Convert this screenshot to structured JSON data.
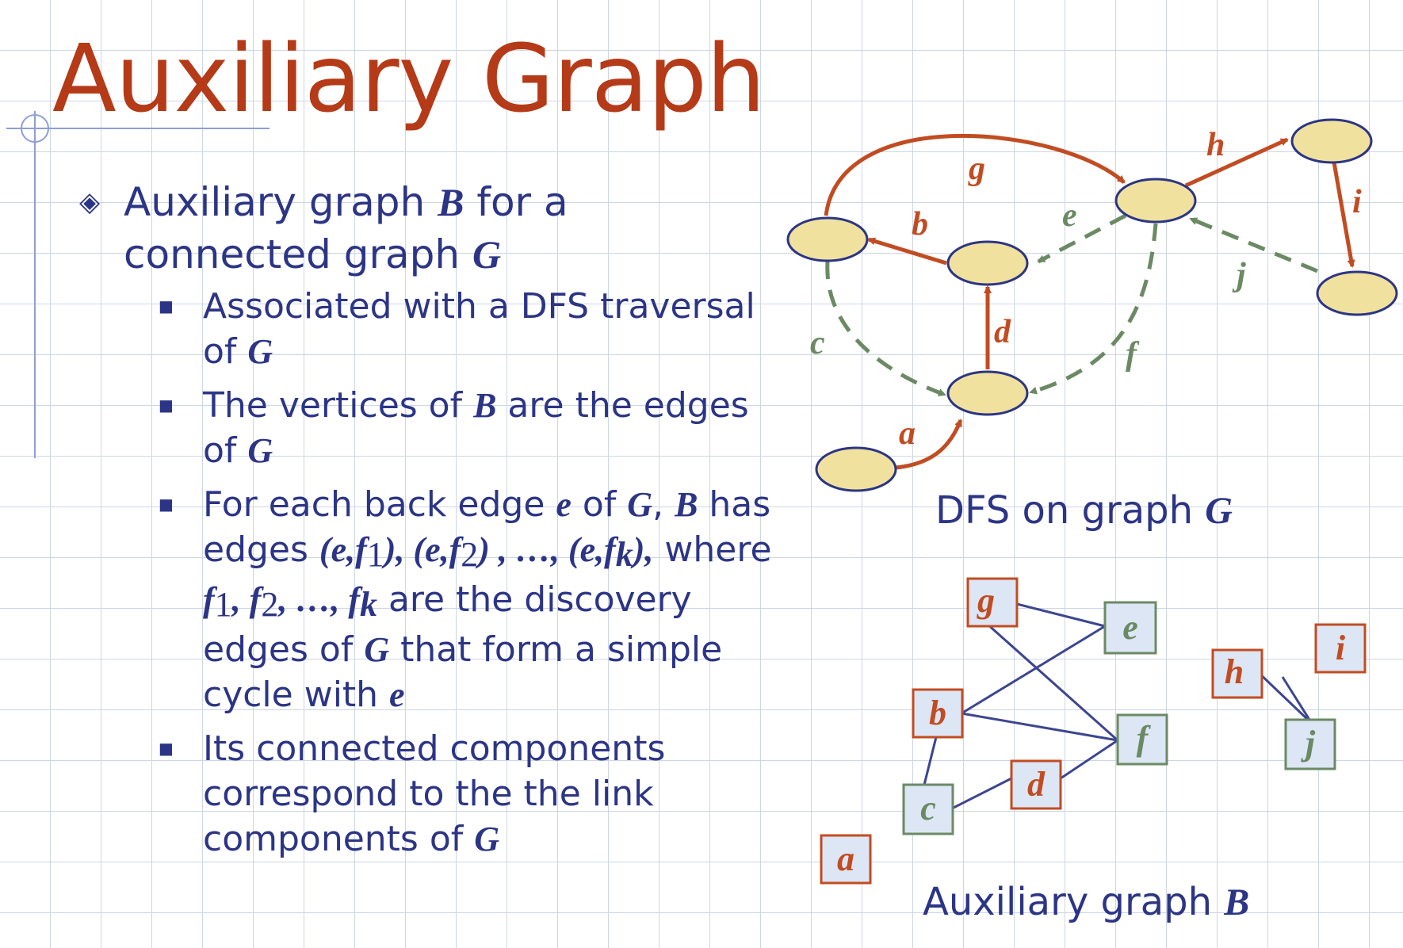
{
  "title": "Auxiliary Graph",
  "bullet": {
    "prefix": "Auxiliary graph ",
    "B": "B",
    "mid": " for a connected graph ",
    "G": "G"
  },
  "subbullets": {
    "s1_a": "Associated with a DFS traversal of ",
    "s1_G": "G",
    "s2_a": "The vertices of ",
    "s2_B": "B",
    "s2_b": " are the edges of ",
    "s2_G": "G",
    "s3_a": "For each back edge ",
    "s3_e": "e",
    "s3_b": " of ",
    "s3_G": "G",
    "s3_c": ", ",
    "s3_B": "B",
    "s3_d": " has edges ",
    "s3_pairs_1": "(e,f",
    "s3_pairs_1s": "1",
    "s3_pairs_2": "), (e,f",
    "s3_pairs_2s": "2",
    "s3_pairs_3": ") , …, (e,f",
    "s3_pairs_3s": "k",
    "s3_pairs_4": "),",
    "s3_where": " where ",
    "s3_f1": "f",
    "s3_f1s": "1",
    "s3_f2": ", f",
    "s3_f2s": "2",
    "s3_fk": ", …, f",
    "s3_fks": "k",
    "s3_e2": " are the discovery edges of ",
    "s3_G2": "G",
    "s3_e3": " that form a simple cycle with ",
    "s3_e4": "e",
    "s4_a": "Its connected components correspond to the  the link components of ",
    "s4_G": "G"
  },
  "captions": {
    "dfs_prefix": "DFS on graph ",
    "dfs_G": "G",
    "aux_prefix": "Auxiliary graph ",
    "aux_B": "B"
  },
  "dfs_edge_labels": {
    "a": "a",
    "b": "b",
    "c": "c",
    "d": "d",
    "e": "e",
    "f": "f",
    "g": "g",
    "h": "h",
    "i": "i",
    "j": "j"
  },
  "aux_nodes": {
    "a": "a",
    "b": "b",
    "c": "c",
    "d": "d",
    "e": "e",
    "f": "f",
    "g": "g",
    "h": "h",
    "i": "i",
    "j": "j"
  },
  "colors": {
    "title": "#b53a17",
    "text": "#2c3585",
    "discovery_edge": "#c24c22",
    "back_edge": "#6b8a64",
    "vertex_fill": "#f0e29e",
    "vertex_stroke": "#2c3585",
    "box_fill": "#dce6f5",
    "box_discovery_border": "#c24c22",
    "box_back_border": "#6b8a64",
    "aux_edge": "#3c4690"
  }
}
